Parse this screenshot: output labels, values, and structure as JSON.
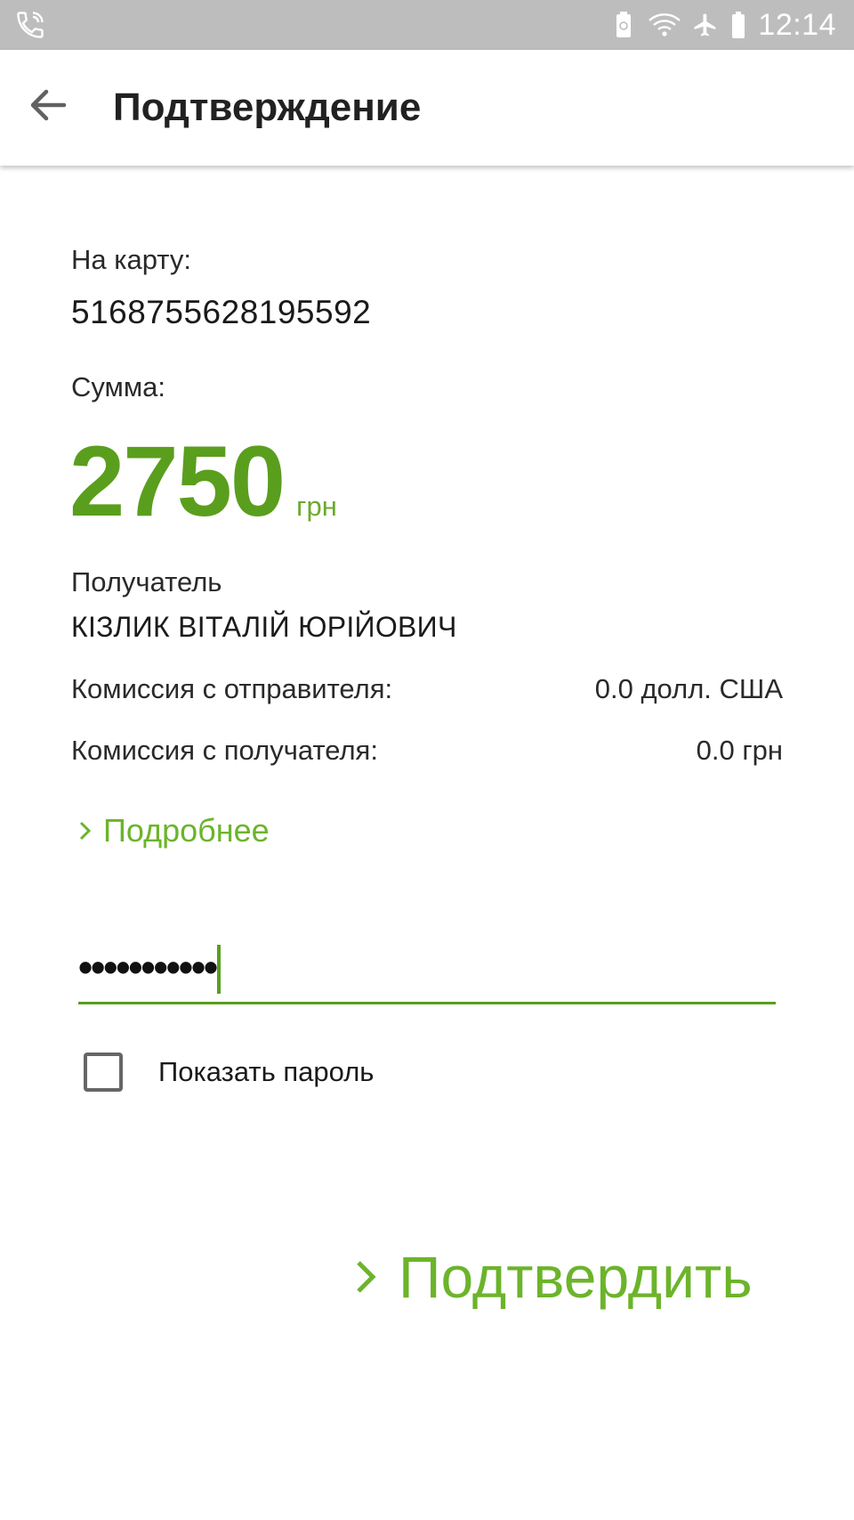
{
  "status_bar": {
    "time": "12:14",
    "icons": [
      "wifi-call-icon",
      "battery-saver-icon",
      "wifi-icon",
      "airplane-mode-icon",
      "battery-icon"
    ]
  },
  "toolbar": {
    "title": "Подтверждение",
    "back_icon": "arrow-back-icon"
  },
  "details": {
    "card_label": "На карту:",
    "card_number": "5168755628195592",
    "sum_label": "Сумма:",
    "amount": "2750",
    "currency": "грн",
    "recipient_label": "Получатель",
    "recipient_name": "КІЗЛИК ВІТАЛІЙ ЮРІЙОВИЧ",
    "fee_sender_label": "Комиссия с отправителя:",
    "fee_sender_value": "0.0 долл. США",
    "fee_recipient_label": "Комиссия с получателя:",
    "fee_recipient_value": "0.0 грн",
    "more_link": "Подробнее"
  },
  "password": {
    "value_masked": "•••••••••••",
    "show_label": "Показать пароль",
    "show_checked": false
  },
  "actions": {
    "confirm_label": "Подтвердить"
  },
  "colors": {
    "accent": "#6cb42b",
    "amount": "#5a9e1e",
    "status_bar": "#bdbdbd"
  }
}
